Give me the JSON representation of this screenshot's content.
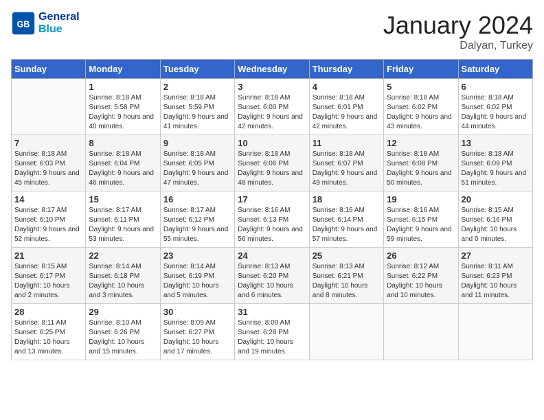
{
  "header": {
    "logo_text_general": "General",
    "logo_text_blue": "Blue",
    "month": "January 2024",
    "location": "Dalyan, Turkey"
  },
  "calendar": {
    "days_of_week": [
      "Sunday",
      "Monday",
      "Tuesday",
      "Wednesday",
      "Thursday",
      "Friday",
      "Saturday"
    ],
    "weeks": [
      [
        {
          "day": "",
          "sunrise": "",
          "sunset": "",
          "daylight": ""
        },
        {
          "day": "1",
          "sunrise": "Sunrise: 8:18 AM",
          "sunset": "Sunset: 5:58 PM",
          "daylight": "Daylight: 9 hours and 40 minutes."
        },
        {
          "day": "2",
          "sunrise": "Sunrise: 8:18 AM",
          "sunset": "Sunset: 5:59 PM",
          "daylight": "Daylight: 9 hours and 41 minutes."
        },
        {
          "day": "3",
          "sunrise": "Sunrise: 8:18 AM",
          "sunset": "Sunset: 6:00 PM",
          "daylight": "Daylight: 9 hours and 42 minutes."
        },
        {
          "day": "4",
          "sunrise": "Sunrise: 8:18 AM",
          "sunset": "Sunset: 6:01 PM",
          "daylight": "Daylight: 9 hours and 42 minutes."
        },
        {
          "day": "5",
          "sunrise": "Sunrise: 8:18 AM",
          "sunset": "Sunset: 6:02 PM",
          "daylight": "Daylight: 9 hours and 43 minutes."
        },
        {
          "day": "6",
          "sunrise": "Sunrise: 8:18 AM",
          "sunset": "Sunset: 6:02 PM",
          "daylight": "Daylight: 9 hours and 44 minutes."
        }
      ],
      [
        {
          "day": "7",
          "sunrise": "Sunrise: 8:18 AM",
          "sunset": "Sunset: 6:03 PM",
          "daylight": "Daylight: 9 hours and 45 minutes."
        },
        {
          "day": "8",
          "sunrise": "Sunrise: 8:18 AM",
          "sunset": "Sunset: 6:04 PM",
          "daylight": "Daylight: 9 hours and 46 minutes."
        },
        {
          "day": "9",
          "sunrise": "Sunrise: 8:18 AM",
          "sunset": "Sunset: 6:05 PM",
          "daylight": "Daylight: 9 hours and 47 minutes."
        },
        {
          "day": "10",
          "sunrise": "Sunrise: 8:18 AM",
          "sunset": "Sunset: 6:06 PM",
          "daylight": "Daylight: 9 hours and 48 minutes."
        },
        {
          "day": "11",
          "sunrise": "Sunrise: 8:18 AM",
          "sunset": "Sunset: 6:07 PM",
          "daylight": "Daylight: 9 hours and 49 minutes."
        },
        {
          "day": "12",
          "sunrise": "Sunrise: 8:18 AM",
          "sunset": "Sunset: 6:08 PM",
          "daylight": "Daylight: 9 hours and 50 minutes."
        },
        {
          "day": "13",
          "sunrise": "Sunrise: 8:18 AM",
          "sunset": "Sunset: 6:09 PM",
          "daylight": "Daylight: 9 hours and 51 minutes."
        }
      ],
      [
        {
          "day": "14",
          "sunrise": "Sunrise: 8:17 AM",
          "sunset": "Sunset: 6:10 PM",
          "daylight": "Daylight: 9 hours and 52 minutes."
        },
        {
          "day": "15",
          "sunrise": "Sunrise: 8:17 AM",
          "sunset": "Sunset: 6:11 PM",
          "daylight": "Daylight: 9 hours and 53 minutes."
        },
        {
          "day": "16",
          "sunrise": "Sunrise: 8:17 AM",
          "sunset": "Sunset: 6:12 PM",
          "daylight": "Daylight: 9 hours and 55 minutes."
        },
        {
          "day": "17",
          "sunrise": "Sunrise: 8:16 AM",
          "sunset": "Sunset: 6:13 PM",
          "daylight": "Daylight: 9 hours and 56 minutes."
        },
        {
          "day": "18",
          "sunrise": "Sunrise: 8:16 AM",
          "sunset": "Sunset: 6:14 PM",
          "daylight": "Daylight: 9 hours and 57 minutes."
        },
        {
          "day": "19",
          "sunrise": "Sunrise: 8:16 AM",
          "sunset": "Sunset: 6:15 PM",
          "daylight": "Daylight: 9 hours and 59 minutes."
        },
        {
          "day": "20",
          "sunrise": "Sunrise: 8:15 AM",
          "sunset": "Sunset: 6:16 PM",
          "daylight": "Daylight: 10 hours and 0 minutes."
        }
      ],
      [
        {
          "day": "21",
          "sunrise": "Sunrise: 8:15 AM",
          "sunset": "Sunset: 6:17 PM",
          "daylight": "Daylight: 10 hours and 2 minutes."
        },
        {
          "day": "22",
          "sunrise": "Sunrise: 8:14 AM",
          "sunset": "Sunset: 6:18 PM",
          "daylight": "Daylight: 10 hours and 3 minutes."
        },
        {
          "day": "23",
          "sunrise": "Sunrise: 8:14 AM",
          "sunset": "Sunset: 6:19 PM",
          "daylight": "Daylight: 10 hours and 5 minutes."
        },
        {
          "day": "24",
          "sunrise": "Sunrise: 8:13 AM",
          "sunset": "Sunset: 6:20 PM",
          "daylight": "Daylight: 10 hours and 6 minutes."
        },
        {
          "day": "25",
          "sunrise": "Sunrise: 8:13 AM",
          "sunset": "Sunset: 6:21 PM",
          "daylight": "Daylight: 10 hours and 8 minutes."
        },
        {
          "day": "26",
          "sunrise": "Sunrise: 8:12 AM",
          "sunset": "Sunset: 6:22 PM",
          "daylight": "Daylight: 10 hours and 10 minutes."
        },
        {
          "day": "27",
          "sunrise": "Sunrise: 8:11 AM",
          "sunset": "Sunset: 6:23 PM",
          "daylight": "Daylight: 10 hours and 11 minutes."
        }
      ],
      [
        {
          "day": "28",
          "sunrise": "Sunrise: 8:11 AM",
          "sunset": "Sunset: 6:25 PM",
          "daylight": "Daylight: 10 hours and 13 minutes."
        },
        {
          "day": "29",
          "sunrise": "Sunrise: 8:10 AM",
          "sunset": "Sunset: 6:26 PM",
          "daylight": "Daylight: 10 hours and 15 minutes."
        },
        {
          "day": "30",
          "sunrise": "Sunrise: 8:09 AM",
          "sunset": "Sunset: 6:27 PM",
          "daylight": "Daylight: 10 hours and 17 minutes."
        },
        {
          "day": "31",
          "sunrise": "Sunrise: 8:09 AM",
          "sunset": "Sunset: 6:28 PM",
          "daylight": "Daylight: 10 hours and 19 minutes."
        },
        {
          "day": "",
          "sunrise": "",
          "sunset": "",
          "daylight": ""
        },
        {
          "day": "",
          "sunrise": "",
          "sunset": "",
          "daylight": ""
        },
        {
          "day": "",
          "sunrise": "",
          "sunset": "",
          "daylight": ""
        }
      ]
    ]
  }
}
